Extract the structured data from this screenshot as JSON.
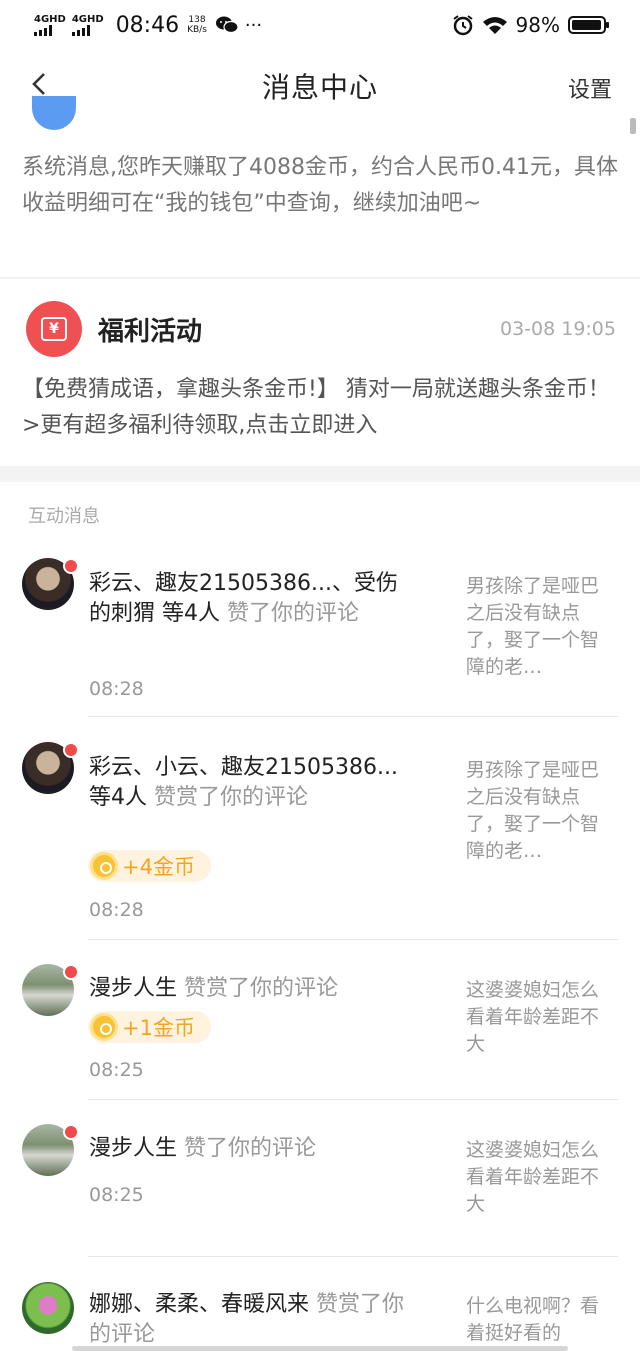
{
  "status": {
    "net1": "4GHD",
    "net2": "4GHD",
    "time": "08:46",
    "speed_value": "138",
    "speed_unit": "KB/s",
    "more": "···",
    "battery": "98%",
    "battery_level": 0.98
  },
  "nav": {
    "title": "消息中心",
    "settings": "设置"
  },
  "system_message": {
    "text": "系统消息,您昨天赚取了4088金币，约合人民币0.41元，具体收益明细可在“我的钱包”中查询，继续加油吧~",
    "avatar_color": "#5b9cf2"
  },
  "welfare": {
    "icon_glyph": "¥",
    "title": "福利活动",
    "time": "03-08 19:05",
    "body": "【免费猜成语，拿趣头条金币!】 猜对一局就送趣头条金币！ >更有超多福利待领取,点击立即进入",
    "icon_color": "#f05052"
  },
  "interactions": {
    "label": "互动消息",
    "items": [
      {
        "names": "彩云、趣友21505386...、受伤的刺猬 等4人",
        "action": " 赞了你的评论",
        "coin": "",
        "time": "08:28",
        "ref": "男孩除了是哑巴之后没有缺点了，娶了一个智障的老…",
        "avatar": "girl-avatar"
      },
      {
        "names": "彩云、小云、趣友21505386... 等4人",
        "action": " 赞赏了你的评论",
        "coin": "+4金币",
        "time": "08:28",
        "ref": "男孩除了是哑巴之后没有缺点了，娶了一个智障的老…",
        "avatar": "girl-avatar"
      },
      {
        "names": "漫步人生",
        "action": " 赞赏了你的评论",
        "coin": "+1金币",
        "time": "08:25",
        "ref": "这婆婆媳妇怎么看着年龄差距不大",
        "avatar": "road-avatar"
      },
      {
        "names": "漫步人生",
        "action": " 赞了你的评论",
        "coin": "",
        "time": "08:25",
        "ref": "这婆婆媳妇怎么看着年龄差距不大",
        "avatar": "road-avatar"
      },
      {
        "names": "娜娜、柔柔、春暖风来",
        "action": " 赞赏了你的评论",
        "coin": "",
        "time": "",
        "ref": "什么电视啊？看着挺好看的",
        "avatar": "lotus-avatar"
      }
    ]
  },
  "colors": {
    "accent_red": "#f04a4a",
    "coin_orange": "#f3a521"
  }
}
